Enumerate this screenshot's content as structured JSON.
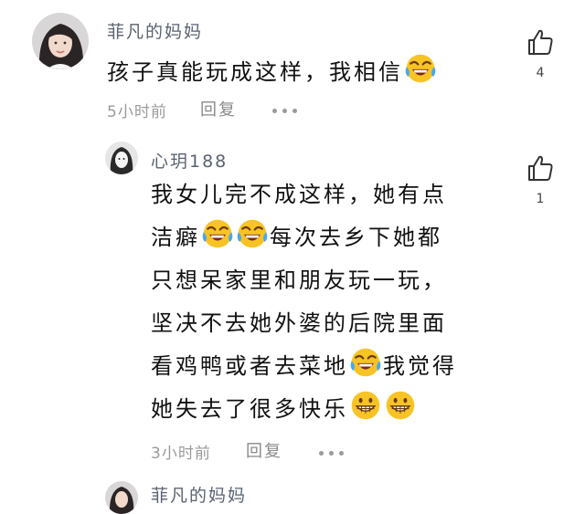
{
  "comments": [
    {
      "username": "菲凡的妈妈",
      "text_before_emoji": "孩子真能玩成这样，我相信",
      "emoji_after_text": "laugh-cry-emoji",
      "time": "5小时前",
      "reply_label": "回复",
      "like_count": "4"
    },
    {
      "username": "心玥188",
      "lines": [
        "我女儿完不成这样，她有点",
        "洁癖",
        "每次去乡下她都",
        "只想呆家里和朋友玩一玩，",
        "坚决不去她外婆的后院里面",
        "看鸡鸭或者去菜地",
        "我觉得",
        "她失去了很多快乐"
      ],
      "time": "3小时前",
      "reply_label": "回复",
      "like_count": "1"
    },
    {
      "username": "菲凡的妈妈"
    }
  ],
  "icons": {
    "like": "thumbs-up-icon",
    "more": "more-dots-icon",
    "laugh": "laugh-cry-emoji",
    "grin": "grin-emoji"
  },
  "colors": {
    "username": "#5a6272",
    "meta": "#9a9a9a",
    "emoji": "#f7c325"
  }
}
